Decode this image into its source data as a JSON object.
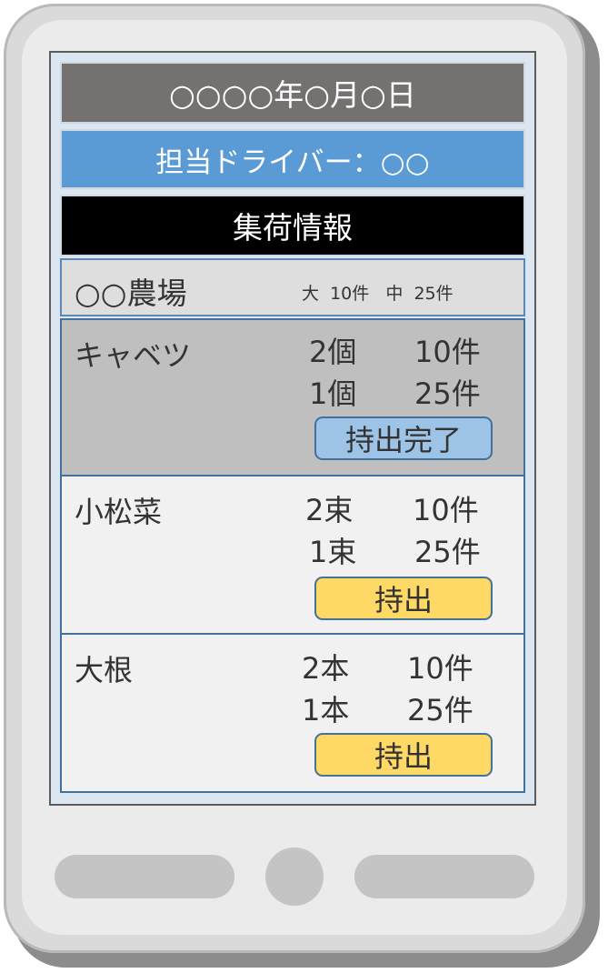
{
  "header": {
    "date": "○○○○年○月○日",
    "driver": "担当ドライバー：○○",
    "section_title": "集荷情報"
  },
  "farm": {
    "name": "○○農場",
    "summary": "大  10件   中  25件"
  },
  "items": [
    {
      "name": "キャベツ",
      "rows": [
        {
          "qty": "2個",
          "count": "10件"
        },
        {
          "qty": "1個",
          "count": "25件"
        }
      ],
      "button_label": "持出完了",
      "button_state": "done",
      "background": "#bfbfbf"
    },
    {
      "name": "小松菜",
      "rows": [
        {
          "qty": "2束",
          "count": "10件"
        },
        {
          "qty": "1束",
          "count": "25件"
        }
      ],
      "button_label": "持出",
      "button_state": "pending",
      "background": "#f1f1f1"
    },
    {
      "name": "大根",
      "rows": [
        {
          "qty": "2本",
          "count": "10件"
        },
        {
          "qty": "1本",
          "count": "25件"
        }
      ],
      "button_label": "持出",
      "button_state": "pending",
      "background": "#f1f1f1"
    }
  ],
  "colors": {
    "date_bar": "#757170",
    "driver_bar": "#5b9bd5",
    "heading_bar": "#000000",
    "done_button": "#9dc3e6",
    "pending_button": "#ffd966"
  }
}
